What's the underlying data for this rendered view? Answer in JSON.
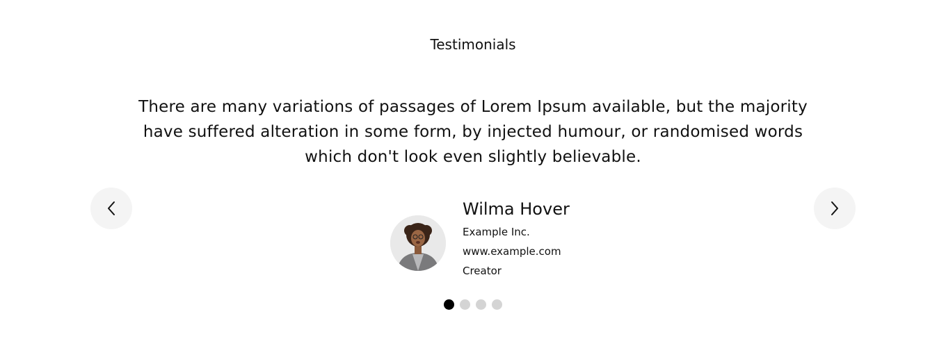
{
  "section": {
    "title": "Testimonials"
  },
  "testimonial": {
    "quote": "There are many variations of passages of Lorem Ipsum available, but the majority have suffered alteration in some form, by injected humour, or randomised words which don't look even slightly believable.",
    "author": {
      "name": "Wilma Hover",
      "company": "Example Inc.",
      "website": "www.example.com",
      "role": "Creator"
    }
  },
  "navigation": {
    "prev_icon": "chevron-left-icon",
    "next_icon": "chevron-right-icon"
  },
  "pagination": {
    "total": 4,
    "active_index": 0
  },
  "colors": {
    "text": "#111111",
    "nav_bg": "#f4f4f4",
    "dot_inactive": "#d4d4d4",
    "dot_active": "#000000"
  }
}
